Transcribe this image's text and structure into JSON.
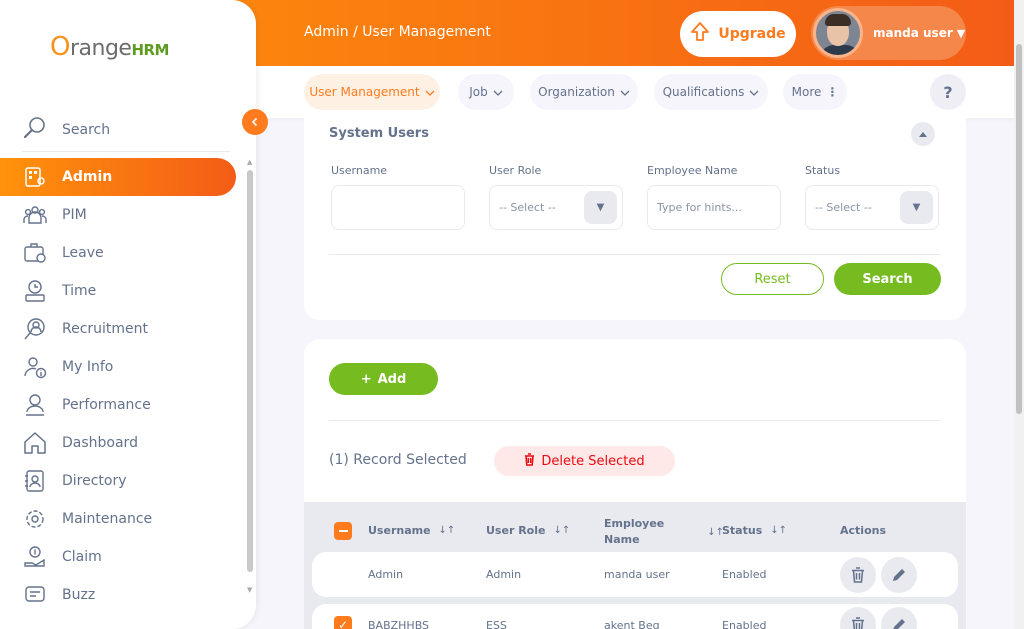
{
  "header": {
    "breadcrumb": "Admin / User Management",
    "upgrade_label": "Upgrade",
    "user_name": "manda user"
  },
  "nav": {
    "tabs": [
      {
        "label": "User Management"
      },
      {
        "label": "Job"
      },
      {
        "label": "Organization"
      },
      {
        "label": "Qualifications"
      },
      {
        "label": "More"
      }
    ],
    "help_label": "?"
  },
  "sidebar": {
    "logo_o": "O",
    "logo_range": "range",
    "logo_hrm": "HRM",
    "search_label": "Search",
    "items": [
      {
        "label": "Admin",
        "icon": "admin-icon"
      },
      {
        "label": "PIM",
        "icon": "pim-icon"
      },
      {
        "label": "Leave",
        "icon": "leave-icon"
      },
      {
        "label": "Time",
        "icon": "time-icon"
      },
      {
        "label": "Recruitment",
        "icon": "recruitment-icon"
      },
      {
        "label": "My Info",
        "icon": "my-info-icon"
      },
      {
        "label": "Performance",
        "icon": "performance-icon"
      },
      {
        "label": "Dashboard",
        "icon": "dashboard-icon"
      },
      {
        "label": "Directory",
        "icon": "directory-icon"
      },
      {
        "label": "Maintenance",
        "icon": "maintenance-icon"
      },
      {
        "label": "Claim",
        "icon": "claim-icon"
      },
      {
        "label": "Buzz",
        "icon": "buzz-icon"
      }
    ]
  },
  "filters": {
    "title": "System Users",
    "username_label": "Username",
    "username_value": "",
    "role_label": "User Role",
    "role_value": "-- Select --",
    "employee_label": "Employee Name",
    "employee_placeholder": "Type for hints...",
    "status_label": "Status",
    "status_value": "-- Select --",
    "reset_label": "Reset",
    "search_label": "Search"
  },
  "records": {
    "add_label": "Add",
    "selected_text": "(1) Record Selected",
    "delete_label": "Delete Selected",
    "columns": [
      "Username",
      "User Role",
      "Employee Name",
      "Status",
      "Actions"
    ],
    "rows": [
      {
        "username": "Admin",
        "role": "Admin",
        "employee": "manda user",
        "status": "Enabled",
        "checked": false
      },
      {
        "username": "BABZHHBS",
        "role": "ESS",
        "employee": "akent Beg",
        "status": "Enabled",
        "checked": true
      }
    ]
  },
  "colors": {
    "accent": "#ff7b1d",
    "accent_dark": "#f35c17",
    "green": "#76bc21",
    "danger": "#eb0910"
  }
}
